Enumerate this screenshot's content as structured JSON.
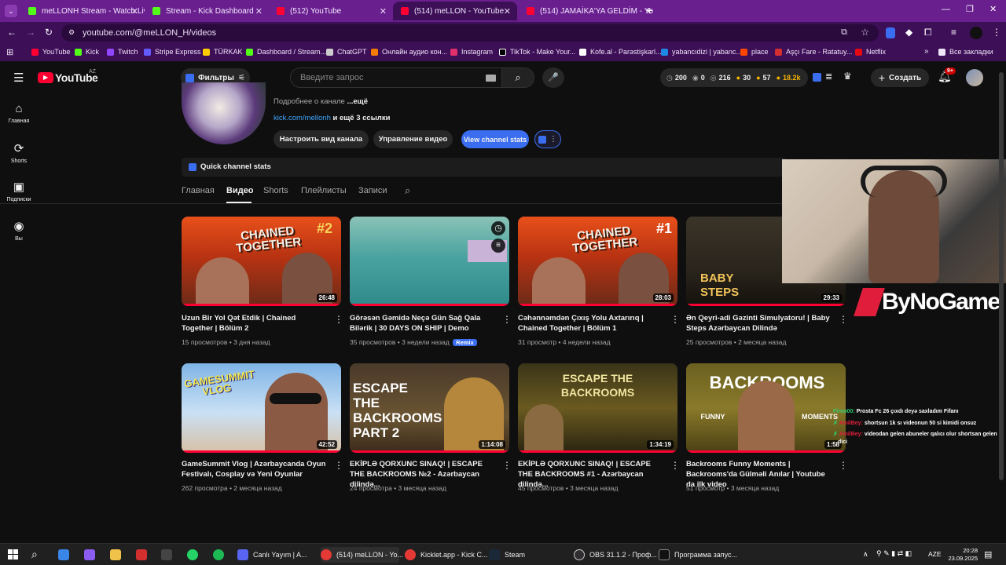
{
  "browser": {
    "tabs": [
      {
        "label": "meLLONH Stream - Watch Live"
      },
      {
        "label": "Stream - Kick Dashboard"
      },
      {
        "label": "(512) YouTube"
      },
      {
        "label": "(514) meLLON - YouTube"
      },
      {
        "label": "(514) JAMAİKA'YA GELDİM - Yo"
      }
    ],
    "url": "youtube.com/@meLLON_H/videos",
    "bookmarks": [
      "YouTube",
      "Kick",
      "Twitch",
      "Stripe Express",
      "TÜRKAK",
      "Dashboard / Stream...",
      "ChatGPT",
      "Онлайн аудио кон...",
      "Instagram",
      "TikTok - Make Your...",
      "Kofe.al - Parəstişkarl...",
      "yabancıdizi | yabanc...",
      "place",
      "Aşçı Fare - Ratatuy...",
      "Netflix"
    ],
    "all_bookmarks": "Все закладки"
  },
  "youtube": {
    "logo": "YouTube",
    "region": "AZ",
    "filters": "Фильтры",
    "search_placeholder": "Введите запрос",
    "stats": [
      "200",
      "0",
      "216",
      "30",
      "57",
      "18.2k"
    ],
    "create": "Создать",
    "notif_badge": "9+"
  },
  "sidebar": [
    {
      "label": "Главная",
      "icon": "home-icon"
    },
    {
      "label": "Shorts",
      "icon": "shorts-icon"
    },
    {
      "label": "Подписки",
      "icon": "subscriptions-icon"
    },
    {
      "label": "Вы",
      "icon": "you-icon"
    }
  ],
  "channel": {
    "about": "Подробнее о канале",
    "more": "...ещё",
    "link": "kick.com/mellonh",
    "link_more": "и ещё 3 ссылки",
    "btn_customize": "Настроить вид канала",
    "btn_manage": "Управление видео",
    "btn_stats": "View channel stats",
    "quick_stats": "Quick channel stats",
    "tabs": [
      "Главная",
      "Видео",
      "Shorts",
      "Плейлисты",
      "Записи"
    ]
  },
  "videos": [
    {
      "title": "Uzun Bir Yol Qət Etdik | Chained Together | Bölüm 2",
      "meta": "15 просмотров • 3 дня назад",
      "duration": "26:48",
      "thumb_text": "CHAINED TOGETHER",
      "thumb_num": "#2"
    },
    {
      "title": "Görəsən Gəmidə Neçə Gün Sağ Qala Bilərik | 30 DAYS ON SHIP | Demo",
      "meta": "35 просмотров • 3 недели назад",
      "badge": "Remix",
      "duration": "",
      "thumb_text": "",
      "thumb_num": ""
    },
    {
      "title": "Cəhənnəmdən Çıxış Yolu Axtarırıq | Chained Together | Bölüm 1",
      "meta": "31 просмотр • 4 недели назад",
      "duration": "28:03",
      "thumb_text": "CHAINED TOGETHER",
      "thumb_num": "#1"
    },
    {
      "title": "Ən Qeyri-adi Gəzinti Simulyatoru! | Baby Steps Azərbaycan Dilində",
      "meta": "25 просмотров • 2 месяца назад",
      "duration": "29:33",
      "thumb_text": "BABY STEPS",
      "thumb_num": ""
    },
    {
      "title": "GameSummit Vlog | Azərbaycanda Oyun Festivalı, Cosplay və Yeni Oyunlar",
      "meta": "262 просмотра • 2 месяца назад",
      "duration": "42:52",
      "thumb_text": "GAMESUMMIT VLOG",
      "thumb_num": ""
    },
    {
      "title": "EKİPLƏ QORXUNC SINAQ! | ESCAPE THE BACKROOMS №2 - Azərbaycan dilində...",
      "meta": "24 просмотра • 3 месяца назад",
      "duration": "1:14:08",
      "thumb_text": "ESCAPE THE BACKROOMS PART 2",
      "thumb_num": ""
    },
    {
      "title": "EKİPLƏ QORXUNC SINAQ! | ESCAPE THE BACKROOMS #1 - Azərbaycan dilində...",
      "meta": "45 просмотров • 3 месяца назад",
      "duration": "1:34:19",
      "thumb_text": "ESCAPE THE BACKROOMS",
      "thumb_num": ""
    },
    {
      "title": "Backrooms Funny Moments | Backrooms'da Gülməli Anılar | Youtube da ilk video",
      "meta": "51 просмотр • 3 месяца назад",
      "duration": "1:58",
      "thumb_text": "BACKROOMS",
      "thumb_sub": "FUNNY MOMENTS",
      "thumb_num": ""
    }
  ],
  "overlay": {
    "brand": "ByNoGame",
    "chat": [
      {
        "user": "Firoo00:",
        "text": "Prosta Fc 26 çıxdı deyə saxladım Fifanı"
      },
      {
        "user": "AmilBey:",
        "text": "shortsun 1k sı videonun 50 si kimidi onsuz"
      },
      {
        "user": "AmilBey:",
        "text": "videodan gelen abuneler qalıcı olur shortsan gelen"
      },
      {
        "user": "",
        "text": "dici"
      }
    ]
  },
  "taskbar": {
    "apps": [
      "Canlı Yayım | A...",
      "(514) meLLON - Yo...",
      "Kicklet.app - Kick C...",
      "Steam",
      "OBS 31.1.2 - Проф...",
      "Программа запус..."
    ],
    "lang": "AZE",
    "time": "20:28",
    "date": "23.09.2025"
  },
  "colors": {
    "accent": "#3ea6ff",
    "brand_red": "#ff0033",
    "chrome_purple": "#3d0f57"
  }
}
